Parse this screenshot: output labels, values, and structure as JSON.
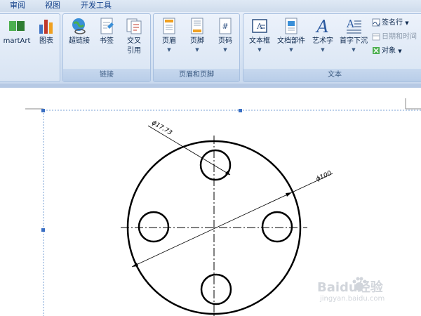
{
  "tabs": [
    "审阅",
    "视图",
    "开发工具"
  ],
  "groups": {
    "illustrations": {
      "buttons": [
        {
          "label": "martArt",
          "icon": "smartart-icon"
        },
        {
          "label": "图表",
          "icon": "chart-icon"
        }
      ]
    },
    "links": {
      "label": "链接",
      "buttons": [
        {
          "label": "超链接",
          "icon": "globe-link-icon"
        },
        {
          "label": "书签",
          "icon": "bookmark-icon"
        },
        {
          "label": "交叉",
          "label2": "引用",
          "icon": "cross-reference-icon"
        }
      ]
    },
    "header_footer": {
      "label": "页眉和页脚",
      "buttons": [
        {
          "label": "页眉",
          "icon": "header-icon"
        },
        {
          "label": "页脚",
          "icon": "footer-icon"
        },
        {
          "label": "页码",
          "icon": "page-number-icon",
          "glyph": "#"
        }
      ]
    },
    "text": {
      "label": "文本",
      "buttons": [
        {
          "label": "文本框",
          "icon": "textbox-icon",
          "glyph": "A"
        },
        {
          "label": "文档部件",
          "icon": "quick-parts-icon"
        },
        {
          "label": "艺术字",
          "icon": "wordart-icon",
          "glyph": "A"
        },
        {
          "label": "首字下沉",
          "icon": "drop-cap-icon",
          "glyph": "A"
        }
      ],
      "small": [
        {
          "label": "签名行",
          "icon": "signature-line-icon",
          "dropdown": true
        },
        {
          "label": "日期和时间",
          "icon": "date-time-icon",
          "disabled": true
        },
        {
          "label": "对象",
          "icon": "object-icon",
          "dropdown": true
        }
      ]
    }
  },
  "drawing": {
    "dim_small": "ϕ17.73",
    "dim_large": "ϕ100"
  },
  "watermark": {
    "brand": "Baidu经验",
    "url": "jingyan.baidu.com"
  }
}
